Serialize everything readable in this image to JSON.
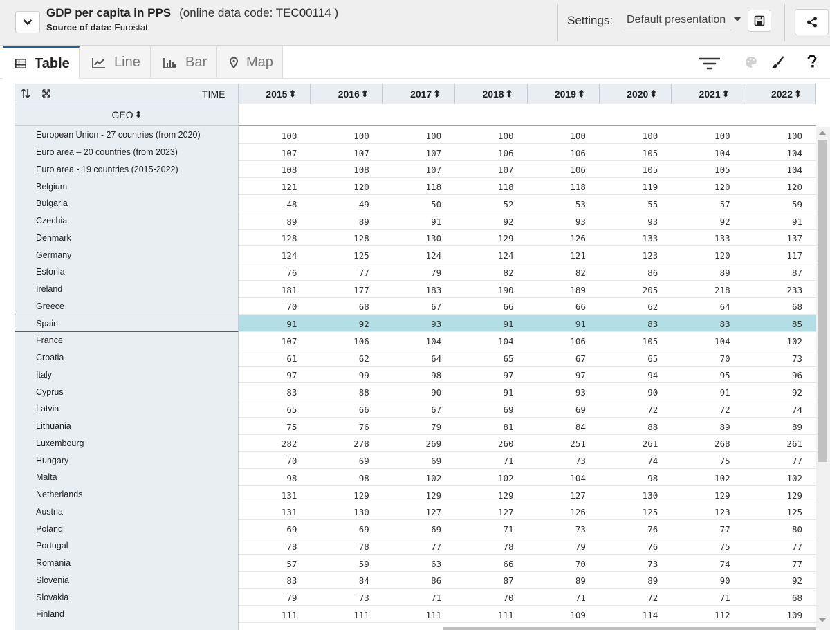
{
  "header": {
    "title": "GDP per capita in PPS",
    "code": "(online data code: TEC00114 )",
    "source_label": "Source of data:",
    "source_value": "Eurostat",
    "settings_label": "Settings:",
    "settings_value": "Default presentation"
  },
  "tabs": [
    {
      "label": "Table",
      "icon": "table-icon",
      "active": true
    },
    {
      "label": "Line",
      "icon": "line-chart-icon"
    },
    {
      "label": "Bar",
      "icon": "bar-chart-icon"
    },
    {
      "label": "Map",
      "icon": "map-pin-icon"
    }
  ],
  "table": {
    "time_label": "TIME",
    "geo_label": "GEO",
    "sort_glyph": "⬍",
    "years": [
      "2015",
      "2016",
      "2017",
      "2018",
      "2019",
      "2020",
      "2021",
      "2022"
    ],
    "highlight_row": "Spain",
    "rows": [
      {
        "name": "European Union - 27 countries (from 2020)",
        "values": [
          "100",
          "100",
          "100",
          "100",
          "100",
          "100",
          "100",
          "100"
        ]
      },
      {
        "name": "Euro area – 20 countries (from 2023)",
        "values": [
          "107",
          "107",
          "107",
          "106",
          "106",
          "105",
          "104",
          "104"
        ]
      },
      {
        "name": "Euro area - 19 countries (2015-2022)",
        "values": [
          "108",
          "108",
          "107",
          "107",
          "106",
          "105",
          "105",
          "104"
        ]
      },
      {
        "name": "Belgium",
        "values": [
          "121",
          "120",
          "118",
          "118",
          "118",
          "119",
          "120",
          "120"
        ]
      },
      {
        "name": "Bulgaria",
        "values": [
          "48",
          "49",
          "50",
          "52",
          "53",
          "55",
          "57",
          "59"
        ]
      },
      {
        "name": "Czechia",
        "values": [
          "89",
          "89",
          "91",
          "92",
          "93",
          "93",
          "92",
          "91"
        ]
      },
      {
        "name": "Denmark",
        "values": [
          "128",
          "128",
          "130",
          "129",
          "126",
          "133",
          "133",
          "137"
        ]
      },
      {
        "name": "Germany",
        "values": [
          "124",
          "125",
          "124",
          "124",
          "121",
          "123",
          "120",
          "117"
        ]
      },
      {
        "name": "Estonia",
        "values": [
          "76",
          "77",
          "79",
          "82",
          "82",
          "86",
          "89",
          "87"
        ]
      },
      {
        "name": "Ireland",
        "values": [
          "181",
          "177",
          "183",
          "190",
          "189",
          "205",
          "218",
          "233"
        ]
      },
      {
        "name": "Greece",
        "values": [
          "70",
          "68",
          "67",
          "66",
          "66",
          "62",
          "64",
          "68"
        ]
      },
      {
        "name": "Spain",
        "values": [
          "91",
          "92",
          "93",
          "91",
          "91",
          "83",
          "83",
          "85"
        ]
      },
      {
        "name": "France",
        "values": [
          "107",
          "106",
          "104",
          "104",
          "106",
          "105",
          "104",
          "102"
        ]
      },
      {
        "name": "Croatia",
        "values": [
          "61",
          "62",
          "64",
          "65",
          "67",
          "65",
          "70",
          "73"
        ]
      },
      {
        "name": "Italy",
        "values": [
          "97",
          "99",
          "98",
          "97",
          "97",
          "94",
          "95",
          "96"
        ]
      },
      {
        "name": "Cyprus",
        "values": [
          "83",
          "88",
          "90",
          "91",
          "93",
          "90",
          "91",
          "92"
        ]
      },
      {
        "name": "Latvia",
        "values": [
          "65",
          "66",
          "67",
          "69",
          "69",
          "72",
          "72",
          "74"
        ]
      },
      {
        "name": "Lithuania",
        "values": [
          "75",
          "76",
          "79",
          "81",
          "84",
          "88",
          "89",
          "89"
        ]
      },
      {
        "name": "Luxembourg",
        "values": [
          "282",
          "278",
          "269",
          "260",
          "251",
          "261",
          "268",
          "261"
        ]
      },
      {
        "name": "Hungary",
        "values": [
          "70",
          "69",
          "69",
          "71",
          "73",
          "74",
          "75",
          "77"
        ]
      },
      {
        "name": "Malta",
        "values": [
          "98",
          "98",
          "102",
          "102",
          "104",
          "98",
          "102",
          "102"
        ]
      },
      {
        "name": "Netherlands",
        "values": [
          "131",
          "129",
          "129",
          "129",
          "127",
          "130",
          "129",
          "129"
        ]
      },
      {
        "name": "Austria",
        "values": [
          "131",
          "130",
          "127",
          "127",
          "126",
          "125",
          "123",
          "125"
        ]
      },
      {
        "name": "Poland",
        "values": [
          "69",
          "69",
          "69",
          "71",
          "73",
          "76",
          "77",
          "80"
        ]
      },
      {
        "name": "Portugal",
        "values": [
          "78",
          "78",
          "77",
          "78",
          "79",
          "76",
          "75",
          "77"
        ]
      },
      {
        "name": "Romania",
        "values": [
          "57",
          "59",
          "63",
          "66",
          "70",
          "73",
          "74",
          "77"
        ]
      },
      {
        "name": "Slovenia",
        "values": [
          "83",
          "84",
          "86",
          "87",
          "89",
          "89",
          "90",
          "92"
        ]
      },
      {
        "name": "Slovakia",
        "values": [
          "79",
          "73",
          "71",
          "70",
          "71",
          "72",
          "71",
          "68"
        ]
      },
      {
        "name": "Finland",
        "values": [
          "111",
          "111",
          "111",
          "111",
          "109",
          "114",
          "112",
          "109"
        ]
      }
    ]
  }
}
